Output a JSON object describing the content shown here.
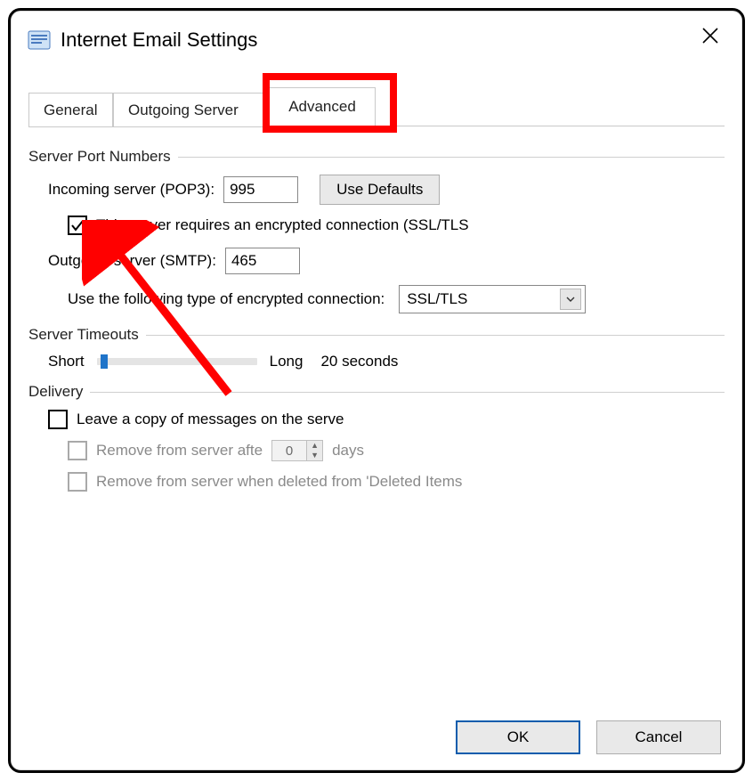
{
  "window": {
    "title": "Internet Email Settings"
  },
  "tabs": {
    "general": "General",
    "outgoing": "Outgoing Server",
    "advanced": "Advanced"
  },
  "groups": {
    "server_ports": {
      "title": "Server Port Numbers",
      "incoming_label": "Incoming server (POP3):",
      "incoming_value": "995",
      "use_defaults_label": "Use Defaults",
      "ssl_checkbox_label": "This server requires an encrypted connection (SSL/TLS",
      "ssl_checked": true,
      "outgoing_label": "Outgoing server (SMTP):",
      "outgoing_value": "465",
      "encryption_label": "Use the following type of encrypted connection:",
      "encryption_value": "SSL/TLS"
    },
    "timeouts": {
      "title": "Server Timeouts",
      "short_label": "Short",
      "long_label": "Long",
      "value_label": "20 seconds"
    },
    "delivery": {
      "title": "Delivery",
      "leave_copy_label": "Leave a copy of messages on the serve",
      "leave_copy_checked": false,
      "remove_after_label": "Remove from server afte",
      "remove_after_days_value": "0",
      "remove_after_days_unit": "days",
      "remove_deleted_label": "Remove from server when deleted from 'Deleted Items"
    }
  },
  "buttons": {
    "ok": "OK",
    "cancel": "Cancel"
  },
  "annotation": {
    "highlight_target": "tab-advanced",
    "arrow_target": "ssl-checkbox"
  }
}
